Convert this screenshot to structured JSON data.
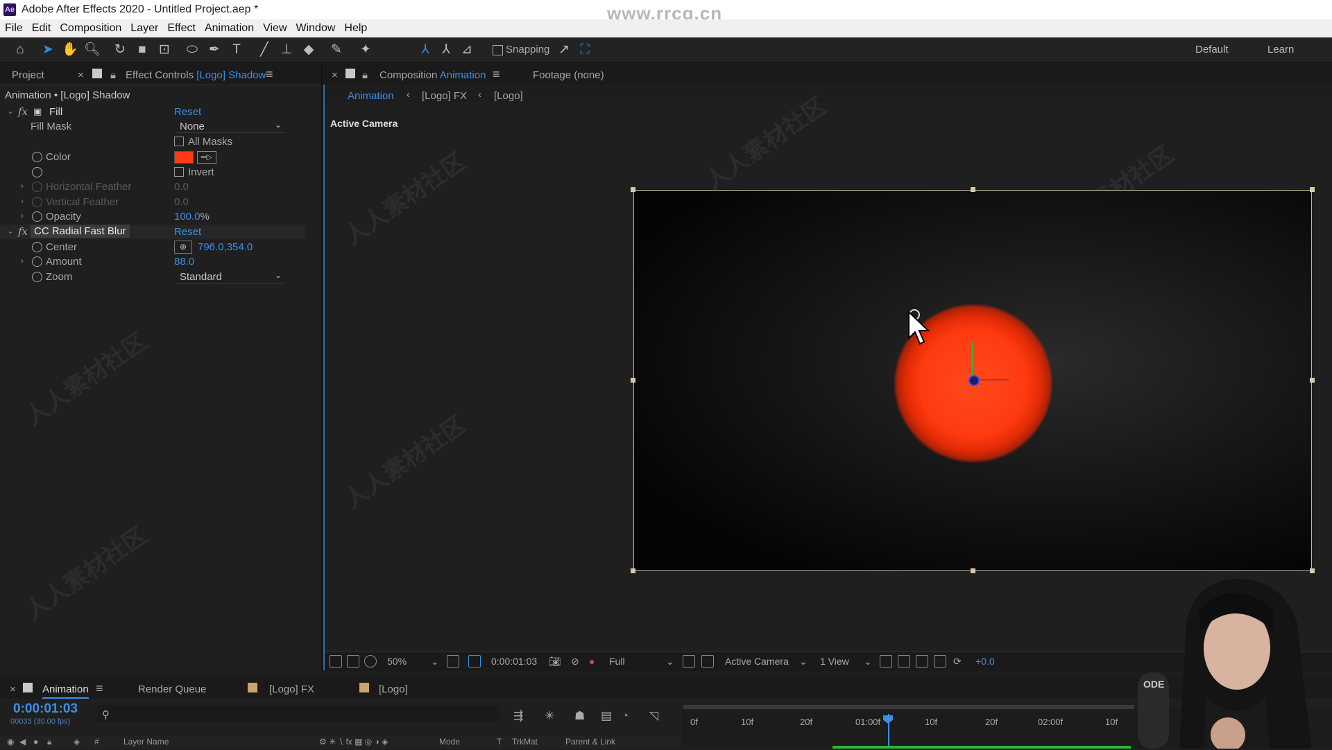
{
  "window": {
    "title": "Adobe After Effects 2020 - Untitled Project.aep *",
    "logo_text": "Ae",
    "watermark": "www.rrcg.cn"
  },
  "menu": [
    "File",
    "Edit",
    "Composition",
    "Layer",
    "Effect",
    "Animation",
    "View",
    "Window",
    "Help"
  ],
  "toolbar": {
    "snapping_label": "Snapping",
    "workspace_default": "Default",
    "workspace_learn": "Learn"
  },
  "left_panel": {
    "tab_project": "Project",
    "tab_effect_controls_prefix": "Effect Controls",
    "tab_effect_controls_layer": "[Logo] Shadow",
    "breadcrumb": "Animation • [Logo] Shadow",
    "fill": {
      "name": "Fill",
      "reset": "Reset",
      "fill_mask_label": "Fill Mask",
      "fill_mask_value": "None",
      "all_masks_label": "All Masks",
      "color_label": "Color",
      "color_value": "#ff3b14",
      "invert_label": "Invert",
      "h_feather_label": "Horizontal Feather",
      "h_feather_value": "0.0",
      "v_feather_label": "Vertical Feather",
      "v_feather_value": "0.0",
      "opacity_label": "Opacity",
      "opacity_value": "100.0",
      "opacity_unit": "%"
    },
    "radial_blur": {
      "name": "CC Radial Fast Blur",
      "reset": "Reset",
      "center_label": "Center",
      "center_value": "796.0,354.0",
      "amount_label": "Amount",
      "amount_value": "88.0",
      "zoom_label": "Zoom",
      "zoom_value": "Standard"
    }
  },
  "comp_panel": {
    "tab_composition_prefix": "Composition",
    "tab_composition_name": "Animation",
    "tab_footage": "Footage  (none)",
    "crumbs": [
      "Animation",
      "[Logo] FX",
      "[Logo]"
    ],
    "active_camera_label": "Active Camera",
    "viewer_bar": {
      "zoom": "50%",
      "timecode": "0:00:01:03",
      "resolution": "Full",
      "camera": "Active Camera",
      "views": "1 View",
      "exposure": "+0.0"
    }
  },
  "timeline": {
    "tabs": [
      "Animation",
      "Render Queue",
      "[Logo] FX",
      "[Logo]"
    ],
    "timecode": "0:00:01:03",
    "frames": "00033 (30.00 fps)",
    "columns": [
      "Layer Name",
      "Mode",
      "T",
      "TrkMat",
      "Parent & Link"
    ],
    "ruler_labels": [
      "0f",
      "10f",
      "20f",
      "01:00f",
      "10f",
      "20f",
      "02:00f",
      "10f"
    ]
  },
  "colors": {
    "accent_blue": "#3d8ee8",
    "background": "#1d1d1d",
    "sun_red": "#ff3a10"
  }
}
